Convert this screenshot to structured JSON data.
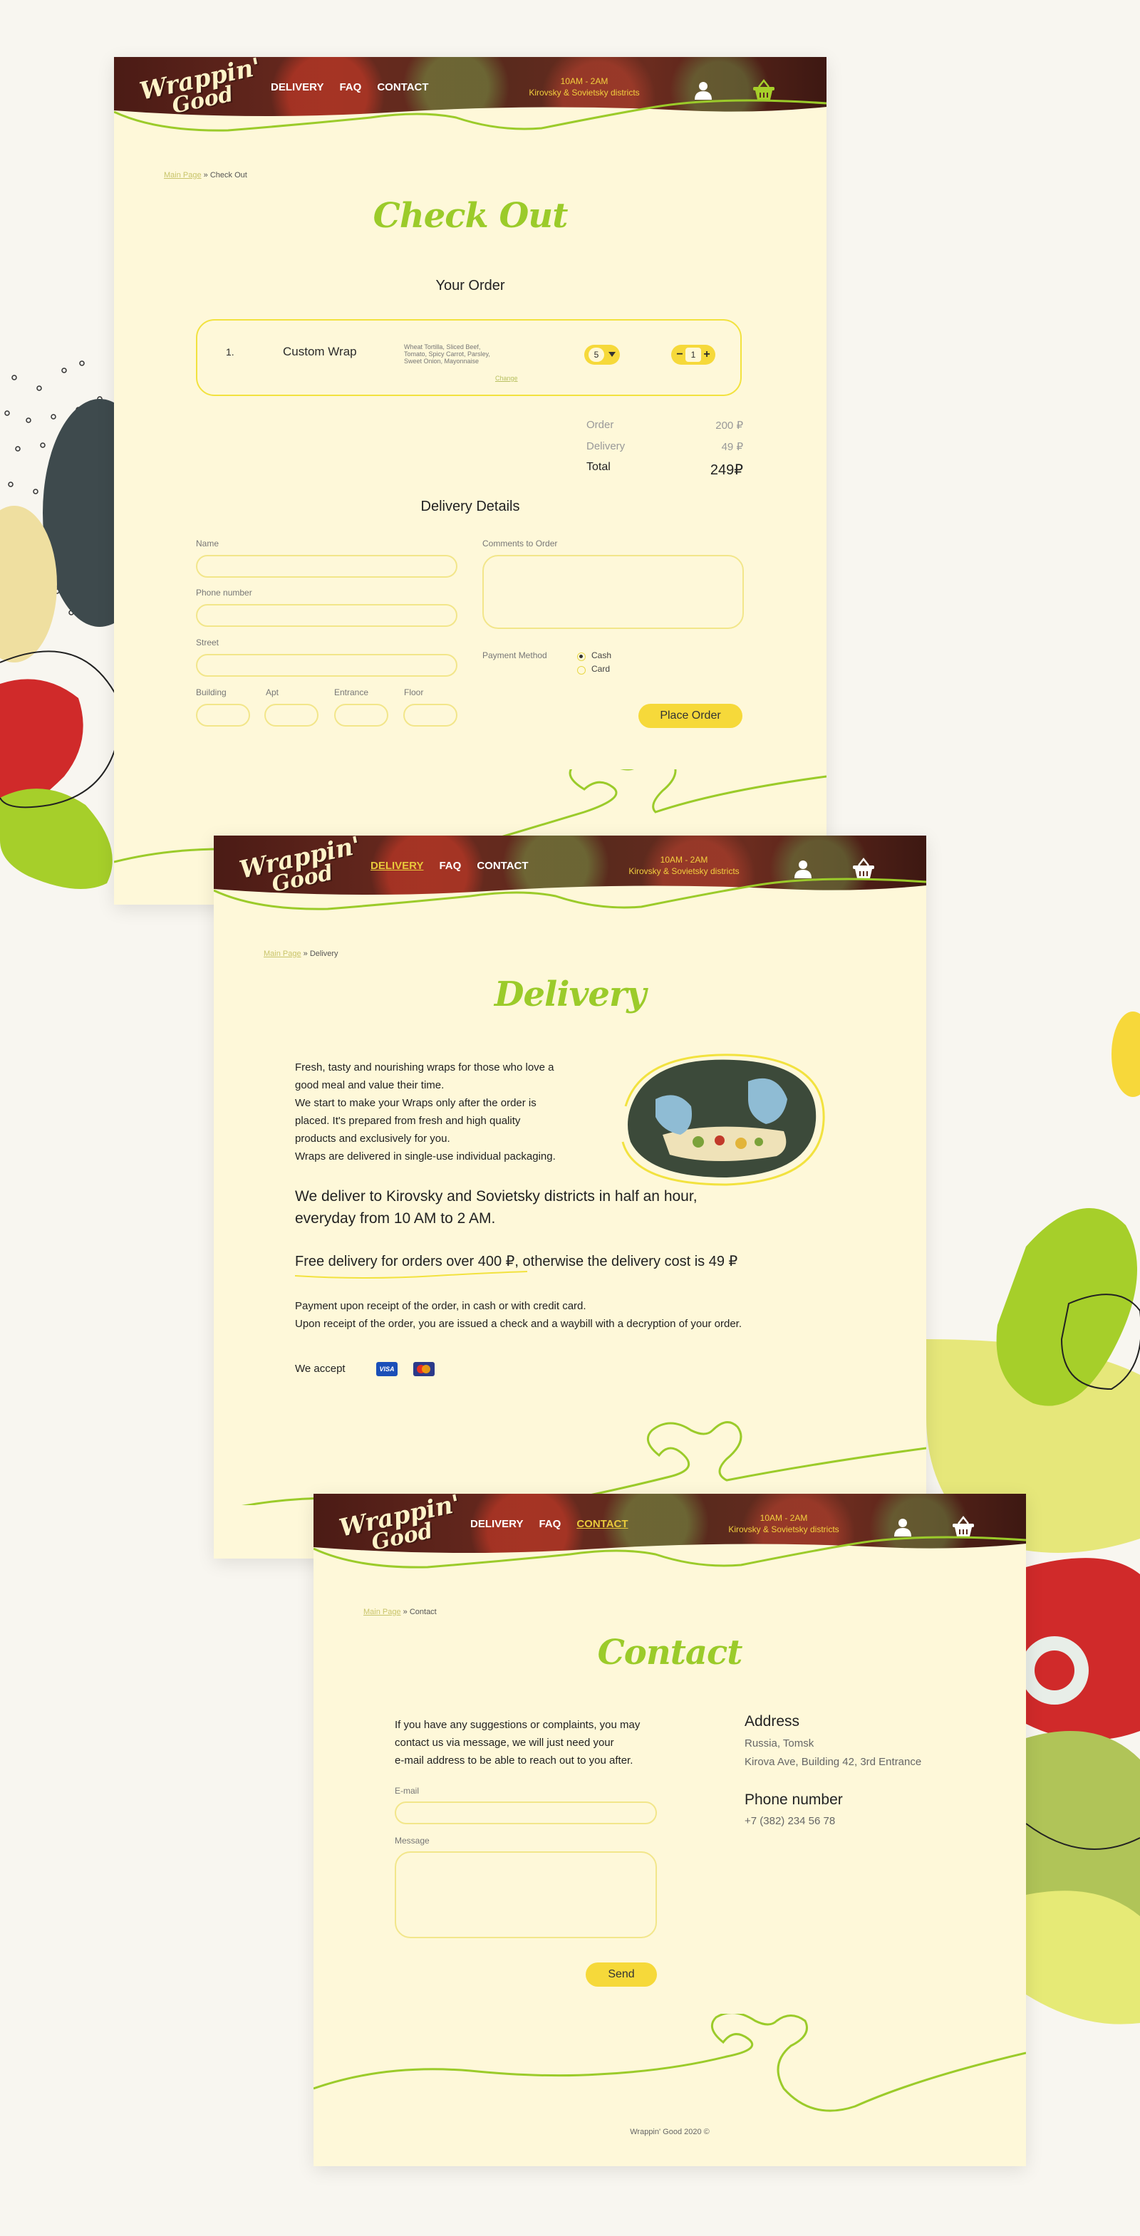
{
  "header": {
    "logo_line1": "Wrappin'",
    "logo_line2": "Good",
    "nav": [
      "DELIVERY",
      "FAQ",
      "CONTACT"
    ],
    "hours": "10AM - 2AM",
    "districts": "Kirovsky & Sovietsky districts",
    "icons": [
      "user-icon",
      "basket-icon"
    ]
  },
  "checkout": {
    "breadcrumb_home": "Main Page",
    "breadcrumb_current": "» Check Out",
    "title": "Check Out",
    "your_order": "Your Order",
    "item": {
      "number": "1.",
      "name": "Custom Wrap",
      "ingredients": "Wheat Tortilla, Sliced Beef, Tomato, Spicy Carrot, Parsley, Sweet Onion, Mayonnaise",
      "change": "Change",
      "size": "5",
      "qty": "1",
      "minus": "−",
      "plus": "+"
    },
    "summary": {
      "order_label": "Order",
      "order_value": "200 ₽",
      "delivery_label": "Delivery",
      "delivery_value": "49 ₽",
      "total_label": "Total",
      "total_value": "249₽"
    },
    "delivery_details": "Delivery Details",
    "fields": {
      "name": "Name",
      "phone": "Phone number",
      "street": "Street",
      "building": "Building",
      "apt": "Apt",
      "entrance": "Entrance",
      "floor": "Floor",
      "comments": "Comments to Order"
    },
    "payment_method": "Payment Method",
    "payment_options": [
      "Cash",
      "Card"
    ],
    "payment_selected": "Cash",
    "place_order": "Place Order"
  },
  "delivery": {
    "breadcrumb_home": "Main Page",
    "breadcrumb_current": "» Delivery",
    "title": "Delivery",
    "intro": [
      "Fresh, tasty and nourishing wraps for those who love a",
      "good meal and value their time.",
      "We start to make your Wraps only after the order is",
      "placed. It's prepared from fresh and high quality",
      "products and exclusively for you.",
      "Wraps are delivered in single-use individual packaging."
    ],
    "area_line1": "We deliver to Kirovsky and Sovietsky districts in half an hour,",
    "area_line2": "everyday from 10 AM to 2 AM.",
    "free_delivery": "Free delivery for orders over 400 ₽, otherwise the delivery cost is 49 ₽",
    "payment_line1": "Payment upon receipt of the order, in cash or with credit card.",
    "payment_line2": "Upon receipt of the order, you are issued a check and a waybill with a decryption of your order.",
    "we_accept": "We accept",
    "cards": [
      "VISA",
      "Mastercard"
    ]
  },
  "contact": {
    "breadcrumb_home": "Main Page",
    "breadcrumb_current": "» Contact",
    "title": "Contact",
    "intro": [
      "If you have any suggestions or complaints, you may",
      "contact us via message, we will just need your",
      "e-mail address to be able to reach out to you after."
    ],
    "email_label": "E-mail",
    "message_label": "Message",
    "send": "Send",
    "address_heading": "Address",
    "address_lines": [
      "Russia, Tomsk",
      "Kirova Ave, Building 42, 3rd Entrance"
    ],
    "phone_heading": "Phone number",
    "phone": "+7 (382) 234 56 78",
    "footer": "Wrappin' Good 2020 ©"
  },
  "colors": {
    "background": "#f8f6f0",
    "page": "#fef8d9",
    "accent_green": "#9bcb2a",
    "accent_yellow": "#f6d93a",
    "header_red": "#5a2a1d"
  }
}
